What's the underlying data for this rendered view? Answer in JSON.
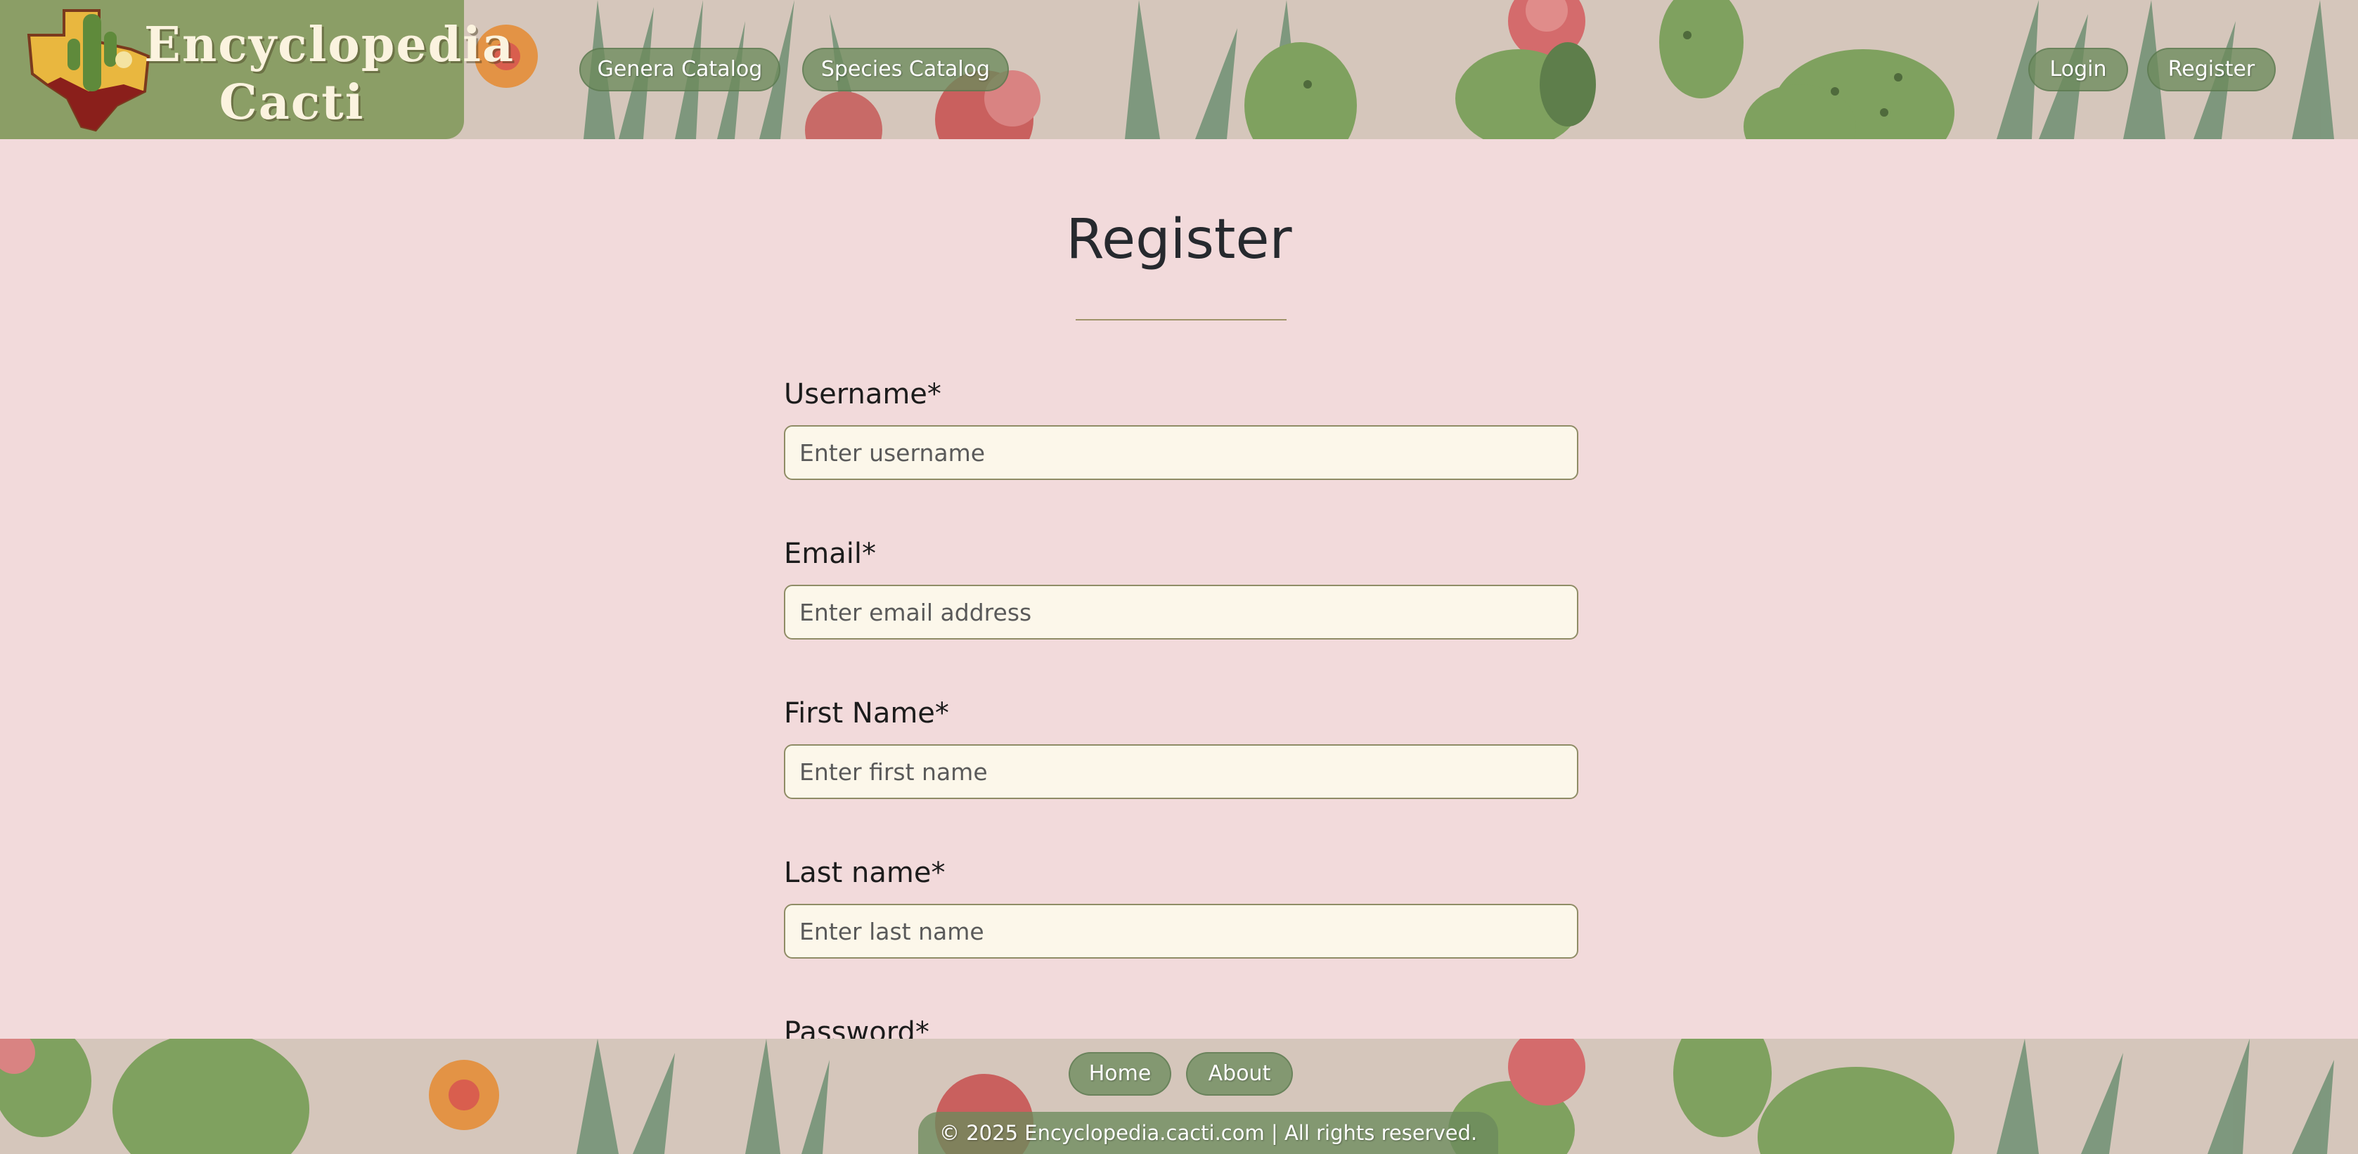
{
  "header": {
    "brand_line_1": "Encyclopedia",
    "brand_line_2": "Cacti",
    "nav": {
      "genera": "Genera Catalog",
      "species": "Species Catalog"
    },
    "auth": {
      "login": "Login",
      "register": "Register"
    }
  },
  "form": {
    "title": "Register",
    "fields": [
      {
        "label": "Username*",
        "placeholder": "Enter username"
      },
      {
        "label": "Email*",
        "placeholder": "Enter email address"
      },
      {
        "label": "First Name*",
        "placeholder": "Enter first name"
      },
      {
        "label": "Last name*",
        "placeholder": "Enter last name"
      },
      {
        "label": "Password*"
      }
    ]
  },
  "footer": {
    "links": {
      "home": "Home",
      "about": "About"
    },
    "copyright": "© 2025 Encyclopedia.cacti.com | All rights reserved."
  },
  "colors": {
    "page_background": "#f2dadb",
    "logo_background": "#8b9e66",
    "pill_background": "#6c8a5c",
    "input_background": "#fcf7ea",
    "accent_rule": "#a0936a"
  },
  "icons": {
    "logo": "texas-cactus-logo-icon"
  }
}
